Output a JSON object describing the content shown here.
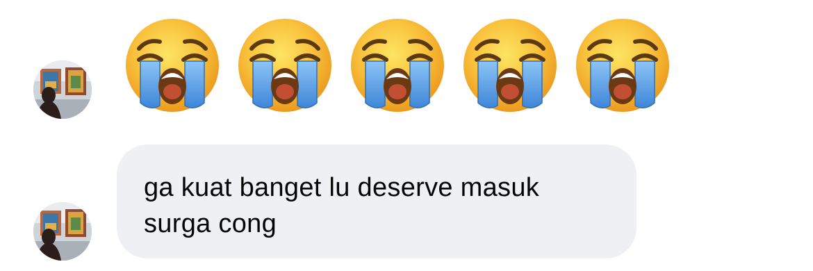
{
  "conversation": {
    "messages": [
      {
        "type": "emoji",
        "emojis": [
          "loudly-crying-face-emoji",
          "loudly-crying-face-emoji",
          "loudly-crying-face-emoji",
          "loudly-crying-face-emoji",
          "loudly-crying-face-emoji"
        ]
      },
      {
        "type": "text",
        "text": "ga kuat banget lu deserve masuk\nsurga cong"
      }
    ]
  },
  "colors": {
    "background": "#ffffff",
    "bubble": "#eff0f3",
    "text": "#050505",
    "emoji_face": "#f7b631",
    "emoji_tears": "#4b97e6"
  }
}
